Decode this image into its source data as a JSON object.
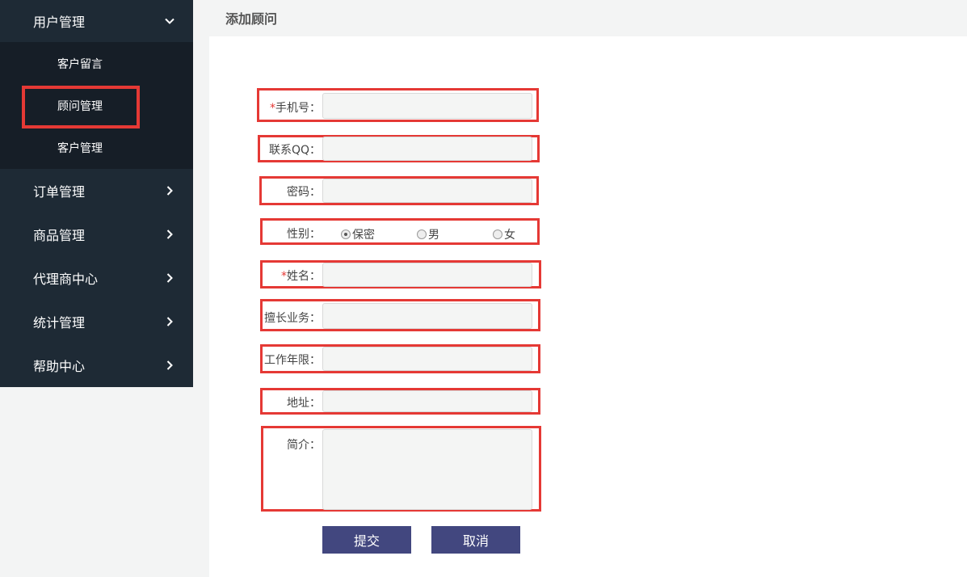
{
  "sidebar": {
    "open_group": {
      "label": "用户管理",
      "icon": "chevron-down-icon"
    },
    "subitems": [
      "客户留言",
      "顾问管理",
      "客户管理"
    ],
    "groups": [
      {
        "label": "订单管理",
        "icon": "chevron-right-icon"
      },
      {
        "label": "商品管理",
        "icon": "chevron-right-icon"
      },
      {
        "label": "代理商中心",
        "icon": "chevron-right-icon"
      },
      {
        "label": "统计管理",
        "icon": "chevron-right-icon"
      },
      {
        "label": "帮助中心",
        "icon": "chevron-right-icon"
      }
    ]
  },
  "page": {
    "title": "添加顾问"
  },
  "form": {
    "phone": {
      "required_mark": "*",
      "label": "手机号：",
      "value": ""
    },
    "qq": {
      "label": "联系QQ：",
      "value": ""
    },
    "password": {
      "label": "密码：",
      "value": ""
    },
    "gender": {
      "label": "性别：",
      "options": [
        "保密",
        "男",
        "女"
      ],
      "selected": "保密"
    },
    "name": {
      "required_mark": "*",
      "label": "姓名：",
      "value": ""
    },
    "specialty": {
      "label": "擅长业务：",
      "value": ""
    },
    "years": {
      "label": "工作年限：",
      "value": ""
    },
    "address": {
      "label": "地址：",
      "value": ""
    },
    "intro": {
      "label": "简介：",
      "value": ""
    },
    "submit_label": "提交",
    "cancel_label": "取消"
  },
  "colors": {
    "sidebar_bg": "#1e2a35",
    "submenu_bg": "#161e27",
    "button_bg": "#42477f",
    "highlight": "#e53935"
  }
}
